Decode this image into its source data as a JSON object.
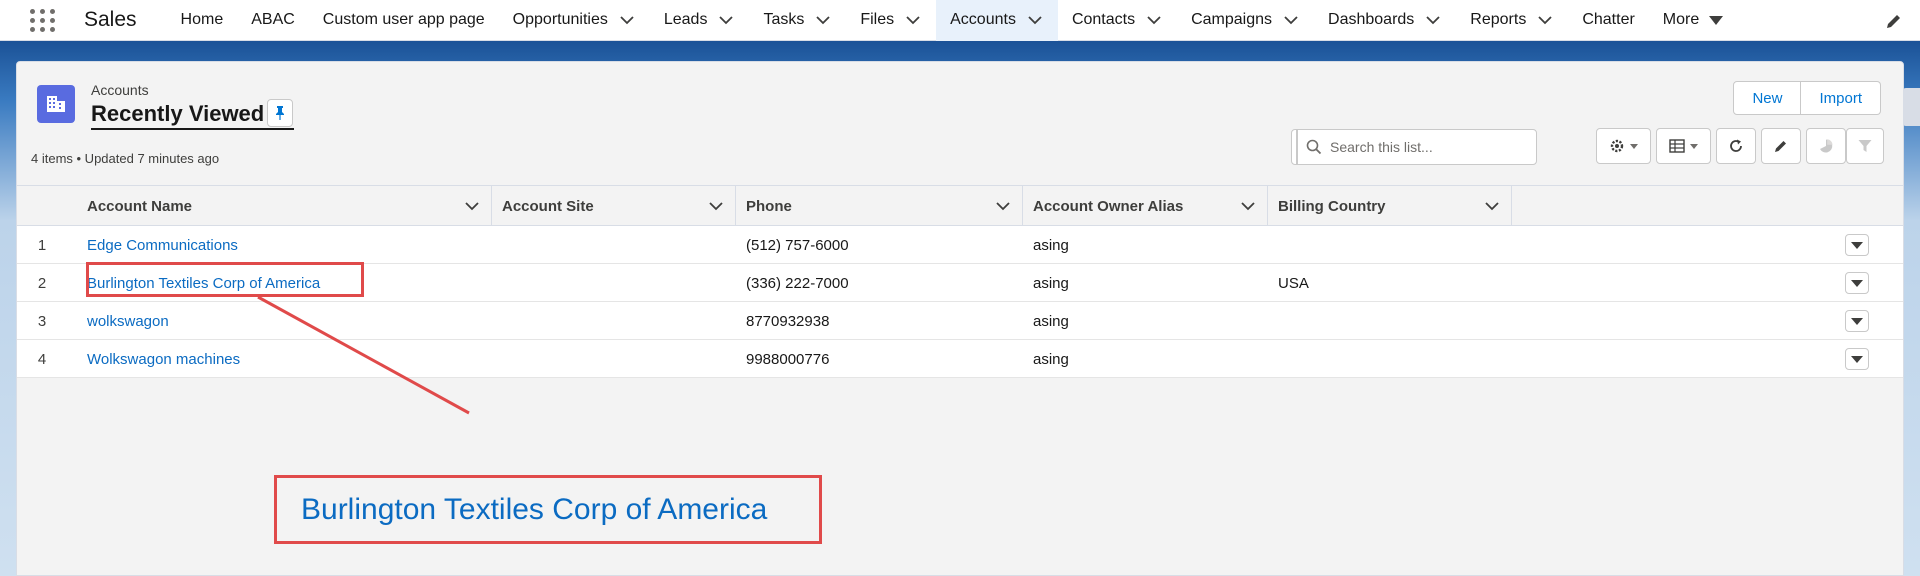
{
  "app": {
    "name": "Sales"
  },
  "nav": {
    "items": [
      {
        "label": "Home",
        "has_menu": false
      },
      {
        "label": "ABAC",
        "has_menu": false
      },
      {
        "label": "Custom user app page",
        "has_menu": false
      },
      {
        "label": "Opportunities",
        "has_menu": true
      },
      {
        "label": "Leads",
        "has_menu": true
      },
      {
        "label": "Tasks",
        "has_menu": true
      },
      {
        "label": "Files",
        "has_menu": true
      },
      {
        "label": "Accounts",
        "has_menu": true,
        "active": true
      },
      {
        "label": "Contacts",
        "has_menu": true
      },
      {
        "label": "Campaigns",
        "has_menu": true
      },
      {
        "label": "Dashboards",
        "has_menu": true
      },
      {
        "label": "Reports",
        "has_menu": true
      },
      {
        "label": "Chatter",
        "has_menu": false
      }
    ],
    "more_label": "More"
  },
  "list_view": {
    "object_label": "Accounts",
    "title": "Recently Viewed",
    "meta": "4 items • Updated 7 minutes ago",
    "new_label": "New",
    "import_label": "Import",
    "search_placeholder": "Search this list..."
  },
  "table": {
    "columns": [
      "Account Name",
      "Account Site",
      "Phone",
      "Account Owner Alias",
      "Billing Country"
    ],
    "rows": [
      {
        "num": "1",
        "name": "Edge Communications",
        "site": "",
        "phone": "(512) 757-6000",
        "owner": "asing",
        "country": ""
      },
      {
        "num": "2",
        "name": "Burlington Textiles Corp of America",
        "site": "",
        "phone": "(336) 222-7000",
        "owner": "asing",
        "country": "USA"
      },
      {
        "num": "3",
        "name": "wolkswagon",
        "site": "",
        "phone": "8770932938",
        "owner": "asing",
        "country": ""
      },
      {
        "num": "4",
        "name": "Wolkswagon machines",
        "site": "",
        "phone": "9988000776",
        "owner": "asing",
        "country": ""
      }
    ]
  },
  "annotation": {
    "callout_text": "Burlington Textiles Corp of America"
  },
  "colors": {
    "brand_blue": "#1b5297",
    "link": "#0b6bc2",
    "highlight": "#e04a4a",
    "object_icon": "#596be0"
  },
  "icons": [
    "app-launcher-icon",
    "chevron-down-icon",
    "edit-pencil-icon",
    "accounts-object-icon",
    "pin-icon",
    "search-icon",
    "settings-gear-icon",
    "table-view-icon",
    "refresh-icon",
    "pencil-icon",
    "chart-icon",
    "filter-icon"
  ]
}
